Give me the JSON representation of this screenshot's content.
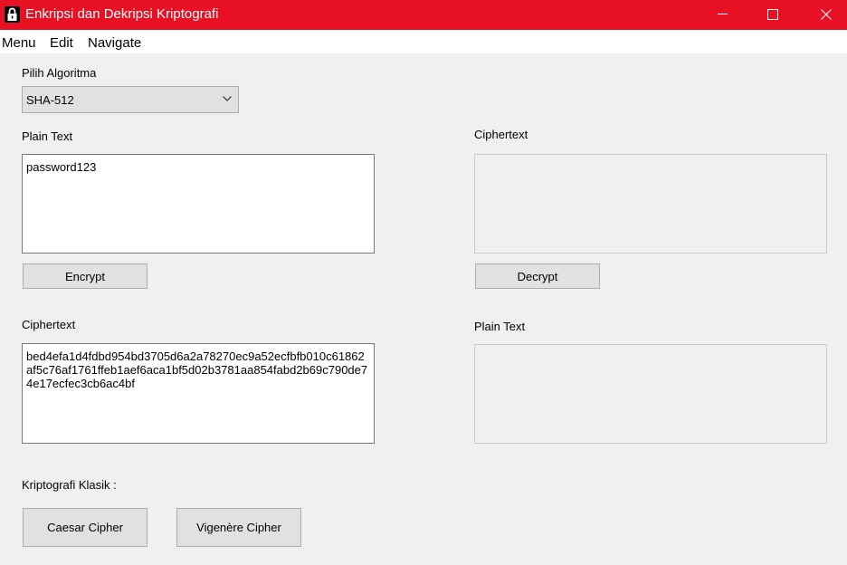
{
  "window": {
    "title": "Enkripsi dan Dekripsi Kriptografi",
    "accent_color": "#e81123",
    "icon": "lock-icon",
    "controls": [
      "minimize-icon",
      "maximize-icon",
      "close-icon"
    ]
  },
  "menu": {
    "items": [
      "Menu",
      "Edit",
      "Navigate"
    ]
  },
  "algorithm": {
    "label": "Pilih Algoritma",
    "selected": "SHA-512"
  },
  "encrypt_section": {
    "plain_label": "Plain Text",
    "plain_value": "password123",
    "button": "Encrypt",
    "cipher_label": "Ciphertext",
    "cipher_value": "bed4efa1d4fdbd954bd3705d6a2a78270ec9a52ecfbfb010c61862af5c76af1761ffeb1aef6aca1bf5d02b3781aa854fabd2b69c790de74e17ecfec3cb6ac4bf"
  },
  "decrypt_section": {
    "cipher_label": "Ciphertext",
    "cipher_value": "",
    "button": "Decrypt",
    "plain_label": "Plain Text",
    "plain_value": ""
  },
  "classic": {
    "label": "Kriptografi Klasik :",
    "buttons": [
      "Caesar Cipher",
      "Vigenère Cipher"
    ]
  }
}
